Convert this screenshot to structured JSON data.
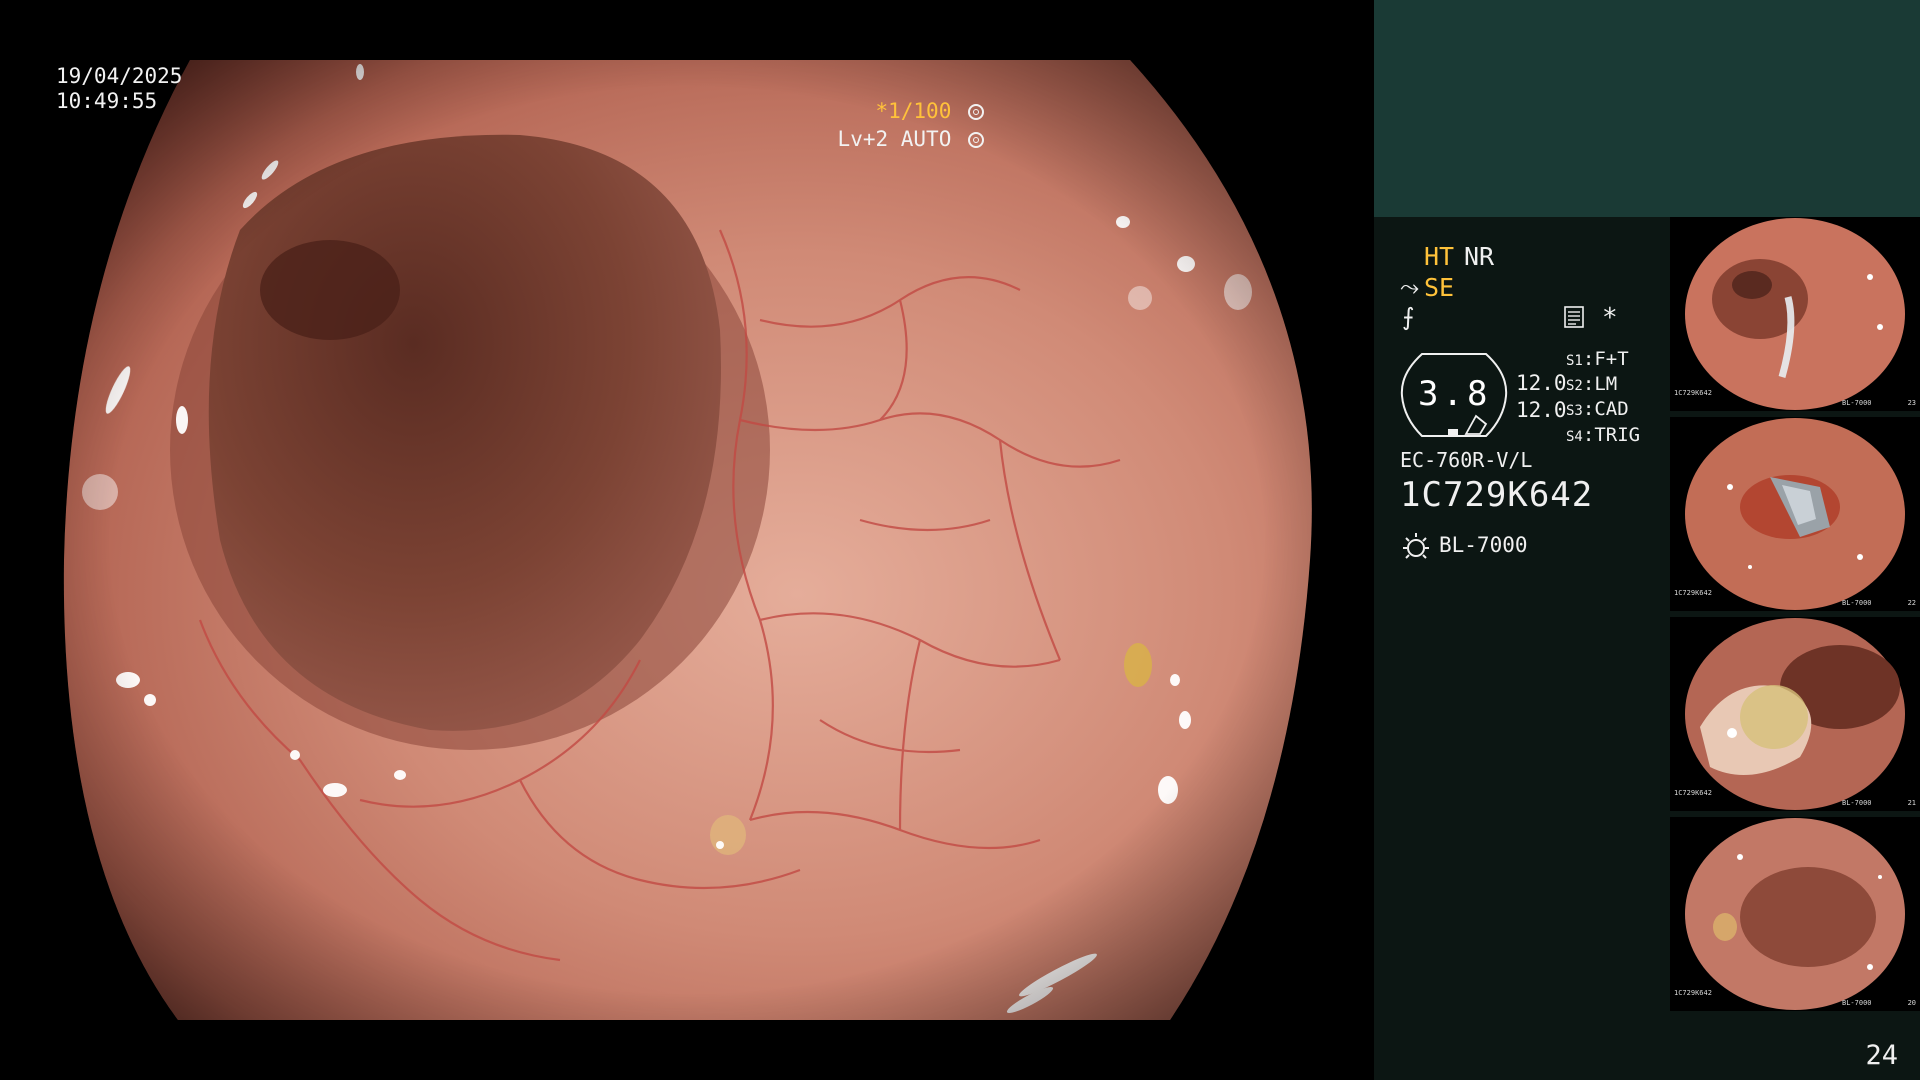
{
  "osd": {
    "date": "19/04/2025",
    "time": "10:49:55",
    "shutter": "*1/100",
    "shutter_icon": "aperture-icon",
    "level": "Lv+2 AUTO"
  },
  "panel": {
    "ht": "HT",
    "nr": "NR",
    "se": "SE",
    "scope_value": "3.8",
    "value_1": "12.0",
    "value_2": "12.0",
    "slots": [
      {
        "key": "S1",
        "value": "F+T"
      },
      {
        "key": "S2",
        "value": "LM"
      },
      {
        "key": "S3",
        "value": "CAD"
      },
      {
        "key": "S4",
        "value": "TRIG"
      }
    ],
    "model": "EC-760R-V/L",
    "serial": "1C729K642",
    "light_source": "BL-7000",
    "page_number": "24",
    "star": "*"
  },
  "thumbnails": [
    {
      "serial": "1C729K642",
      "light": "BL-7000",
      "index": "23"
    },
    {
      "serial": "1C729K642",
      "light": "BL-7000",
      "index": "22"
    },
    {
      "serial": "1C729K642",
      "light": "BL-7000",
      "index": "21"
    },
    {
      "serial": "1C729K642",
      "light": "BL-7000",
      "index": "20"
    }
  ],
  "colors": {
    "mucosa": "#c97a6a",
    "lumen": "#6e3a2c",
    "vessel": "#c8504a",
    "panel_bg": "#0c1613",
    "panel_header": "#1a3a35",
    "highlight_text": "#ffc23a"
  }
}
